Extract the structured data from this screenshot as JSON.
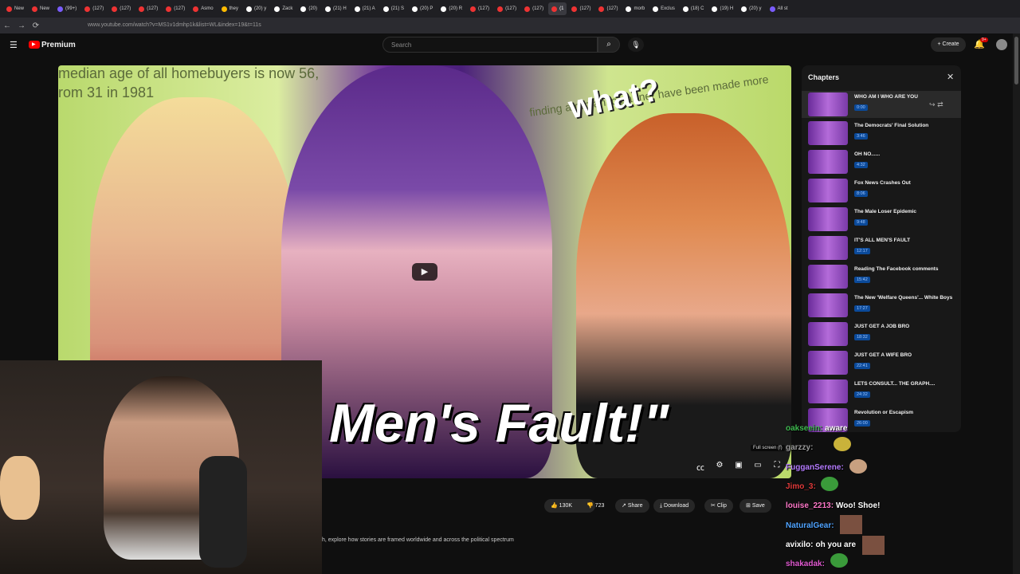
{
  "browser": {
    "tabs": [
      {
        "label": "New",
        "color": "#e33"
      },
      {
        "label": "New",
        "color": "#e33"
      },
      {
        "label": "(99+)",
        "color": "#7a5cff"
      },
      {
        "label": "(127)",
        "color": "#e33"
      },
      {
        "label": "(127)",
        "color": "#e33"
      },
      {
        "label": "(127)",
        "color": "#e33"
      },
      {
        "label": "(127)",
        "color": "#e33"
      },
      {
        "label": "Asmo",
        "color": "#e33"
      },
      {
        "label": "they",
        "color": "#fb0"
      },
      {
        "label": "(20) y",
        "color": "#fff"
      },
      {
        "label": "Zack",
        "color": "#fff"
      },
      {
        "label": "(20)",
        "color": "#fff"
      },
      {
        "label": "(21) H",
        "color": "#fff"
      },
      {
        "label": "(21) A",
        "color": "#fff"
      },
      {
        "label": "(21) S",
        "color": "#fff"
      },
      {
        "label": "(20) P",
        "color": "#fff"
      },
      {
        "label": "(20) R",
        "color": "#fff"
      },
      {
        "label": "(127)",
        "color": "#e33"
      },
      {
        "label": "(127)",
        "color": "#e33"
      },
      {
        "label": "(127)",
        "color": "#e33"
      },
      {
        "label": "(1",
        "color": "#e33",
        "active": true
      },
      {
        "label": "(127)",
        "color": "#e33"
      },
      {
        "label": "(127)",
        "color": "#e33"
      },
      {
        "label": "morb",
        "color": "#fff"
      },
      {
        "label": "Exclus",
        "color": "#fff"
      },
      {
        "label": "(18) C",
        "color": "#fff"
      },
      {
        "label": "(19) H",
        "color": "#fff"
      },
      {
        "label": "(20) y",
        "color": "#fff"
      },
      {
        "label": "All st",
        "color": "#7a5cff"
      }
    ],
    "url": "www.youtube.com/watch?v=MS1v1dmhp1k&list=WL&index=19&t=11s"
  },
  "youtube": {
    "logo_text": "Premium",
    "search_placeholder": "Search",
    "create_label": "Create",
    "notification_count": "9+"
  },
  "video": {
    "title_overlay": "Men's Fault!\"",
    "what_overlay": "what?",
    "bg_text_1": "median age of all homebuyers is now 56,",
    "bg_text_2": "rom 31 in 1981",
    "bg_text_3": "finding a romantic partner have been made more",
    "fullscreen_tooltip": "Full screen (f)"
  },
  "actions": {
    "likes": "130K",
    "dislikes": "723",
    "share": "Share",
    "download": "Download",
    "clip": "Clip",
    "save": "Save"
  },
  "description": "h, explore how stories are framed worldwide and across the political spectrum",
  "chapters": {
    "heading": "Chapters",
    "items": [
      {
        "title": "WHO AM I WHO ARE YOU",
        "time": "0:00",
        "active": true
      },
      {
        "title": "The Democrats' Final Solution",
        "time": "3:46"
      },
      {
        "title": "OH NO......",
        "time": "4:32"
      },
      {
        "title": "Fox News Crashes Out",
        "time": "8:06"
      },
      {
        "title": "The Male Loser Epidemic",
        "time": "9:48"
      },
      {
        "title": "IT'S ALL MEN'S FAULT",
        "time": "12:17"
      },
      {
        "title": "Reading The Facebook comments",
        "time": "15:42"
      },
      {
        "title": "The New 'Welfare Queens'... White Boys",
        "time": "17:27"
      },
      {
        "title": "JUST GET A JOB BRO",
        "time": "18:32"
      },
      {
        "title": "JUST GET A WIFE BRO",
        "time": "22:41"
      },
      {
        "title": "LETS CONSULT... THE GRAPH....",
        "time": "24:32"
      },
      {
        "title": "Revolution or Escapism",
        "time": "26:00"
      }
    ]
  },
  "chat": [
    {
      "user": "oakseein:",
      "msg": "aware",
      "color": "#3fb950"
    },
    {
      "user": "garzzy:",
      "msg": "",
      "color": "#9a9a9a"
    },
    {
      "user": "FugganSerene:",
      "msg": "",
      "color": "#b57bff"
    },
    {
      "user": "Jimo_3:",
      "msg": "",
      "color": "#e03a3a"
    },
    {
      "user": "louise_2213:",
      "msg": "Woo! Shoe!",
      "color": "#ff77c8"
    },
    {
      "user": "NaturalGear:",
      "msg": "",
      "color": "#4fa3ff"
    },
    {
      "user": "avixilo:",
      "msg": "oh you are",
      "color": "#ffffff"
    },
    {
      "user": "shakadak:",
      "msg": "",
      "color": "#e05ad0"
    }
  ]
}
